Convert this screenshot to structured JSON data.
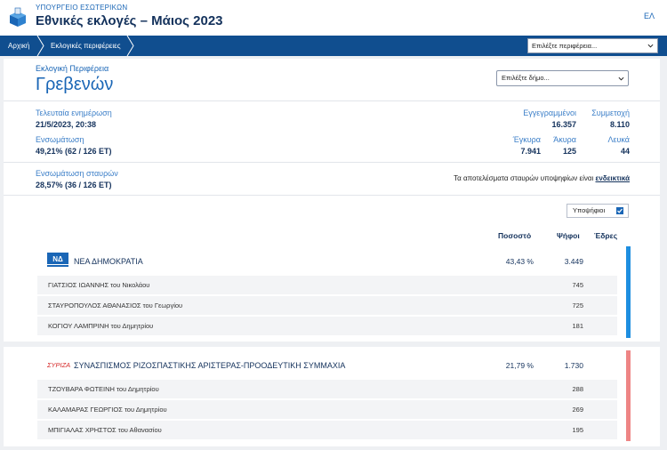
{
  "header": {
    "ministry": "ΥΠΟΥΡΓΕΙΟ ΕΣΩΤΕΡΙΚΩΝ",
    "title": "Εθνικές εκλογές – Μάιος 2023",
    "lang": "ΕΛ"
  },
  "nav": {
    "home": "Αρχική",
    "regions": "Εκλογικές περιφέρειες",
    "region_select": "Επιλέξτε περιφέρεια..."
  },
  "district": {
    "label": "Εκλογική Περιφέρεια",
    "name": "Γρεβενών",
    "muni_select": "Επιλέξτε δήμο..."
  },
  "stats": {
    "last_update_label": "Τελευταία ενημέρωση",
    "last_update": "21/5/2023, 20:38",
    "integration_label": "Ενσωμάτωση",
    "integration": "49,21% (62 / 126 ΕΤ)",
    "registered_label": "Εγγεγραμμένοι",
    "registered": "16.357",
    "turnout_label": "Συμμετοχή",
    "turnout": "8.110",
    "valid_label": "Έγκυρα",
    "valid": "7.941",
    "invalid_label": "Άκυρα",
    "invalid": "125",
    "blank_label": "Λευκά",
    "blank": "44",
    "cross_label": "Ενσωμάτωση σταυρών",
    "cross": "28,57% (36 / 126 ΕΤ)",
    "note_text": "Τα αποτελέσματα σταυρών υποψηφίων είναι",
    "note_emph": "ενδεικτικά"
  },
  "results": {
    "candidates_toggle": "Υποψήφιοι",
    "col_percent": "Ποσοστό",
    "col_votes": "Ψήφοι",
    "col_seats": "Έδρες",
    "parties": [
      {
        "logo": "ΝΔ",
        "name": "ΝΕΑ ΔΗΜΟΚΡΑΤΙΑ",
        "percent": "43,43 %",
        "votes": "3.449",
        "color": "#1e8ee0",
        "candidates": [
          {
            "name": "ΓΙΑΤΣΙΟΣ ΙΩΑΝΝΗΣ του Νικολάου",
            "votes": "745"
          },
          {
            "name": "ΣΤΑΥΡΟΠΟΥΛΟΣ ΑΘΑΝΑΣΙΟΣ του Γεωργίου",
            "votes": "725"
          },
          {
            "name": "ΚΟΓΙΟΥ ΛΑΜΠΡΙΝΗ του Δημητρίου",
            "votes": "181"
          }
        ]
      },
      {
        "logo": "ΣΥΡΙΖΑ",
        "name": "ΣΥΝΑΣΠΙΣΜΟΣ ΡΙΖΟΣΠΑΣΤΙΚΗΣ ΑΡΙΣΤΕΡΑΣ-ΠΡΟΟΔΕΥΤΙΚΗ ΣΥΜΜΑΧΙΑ",
        "percent": "21,79 %",
        "votes": "1.730",
        "color": "#ee8585",
        "candidates": [
          {
            "name": "ΤΖΟΥΒΑΡΑ ΦΩΤΕΙΝΗ του Δημητρίου",
            "votes": "288"
          },
          {
            "name": "ΚΑΛΑΜΑΡΑΣ ΓΕΩΡΓΙΟΣ του Δημητρίου",
            "votes": "269"
          },
          {
            "name": "ΜΠΙΓΙΑΛΑΣ ΧΡΗΣΤΟΣ του Αθανασίου",
            "votes": "195"
          }
        ]
      }
    ]
  }
}
